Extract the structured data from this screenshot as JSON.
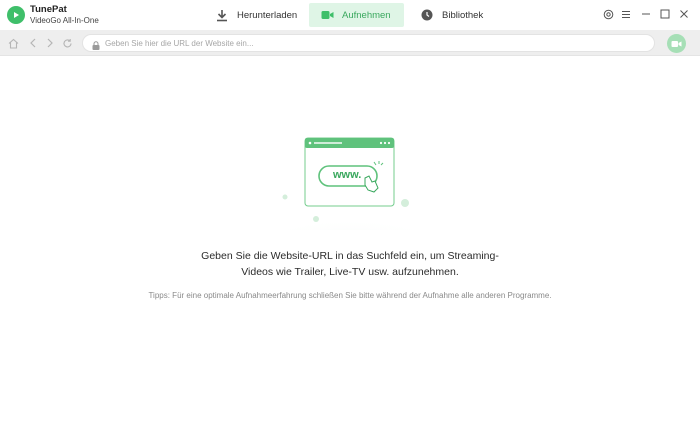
{
  "app": {
    "name": "TunePat",
    "subtitle": "VideoGo All-In-One"
  },
  "tabs": [
    {
      "label": "Herunterladen",
      "icon": "download-icon",
      "active": false
    },
    {
      "label": "Aufnehmen",
      "icon": "video-camera-icon",
      "active": true
    },
    {
      "label": "Bibliothek",
      "icon": "clock-icon",
      "active": false
    }
  ],
  "window_controls": [
    "settings-icon",
    "menu-icon",
    "minimize-icon",
    "maximize-icon",
    "close-icon"
  ],
  "address_bar": {
    "placeholder": "Geben Sie hier die URL der Website ein...",
    "value": ""
  },
  "illustration": {
    "text": "www."
  },
  "main": {
    "message_line1": "Geben Sie die Website-URL in das Suchfeld ein, um Streaming-",
    "message_line2": "Videos wie Trailer, Live-TV usw. aufzunehmen.",
    "tip": "Tipps: Für eine optimale Aufnahmeerfahrung schließen Sie bitte während der Aufnahme alle anderen Programme."
  },
  "colors": {
    "accent": "#3fbf6a",
    "active_tab_bg": "#dff5e6",
    "toolbar_bg": "#eeeeee"
  }
}
